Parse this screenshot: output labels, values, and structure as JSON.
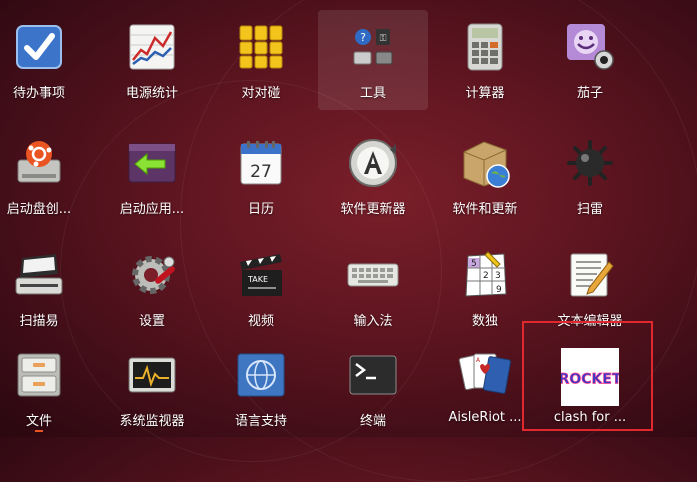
{
  "apps": [
    {
      "label": "待办事项",
      "icon": "todo-checkbox-icon"
    },
    {
      "label": "电源统计",
      "icon": "power-stats-chart-icon"
    },
    {
      "label": "对对碰",
      "icon": "swell-foop-icon"
    },
    {
      "label": "工具",
      "icon": "utilities-folder-icon"
    },
    {
      "label": "计算器",
      "icon": "calculator-icon"
    },
    {
      "label": "茄子",
      "icon": "cheese-webcam-icon"
    },
    {
      "label": "启动盘创...",
      "icon": "startup-disk-icon"
    },
    {
      "label": "启动应用...",
      "icon": "startup-apps-icon"
    },
    {
      "label": "日历",
      "icon": "calendar-icon"
    },
    {
      "label": "软件更新器",
      "icon": "software-updater-icon"
    },
    {
      "label": "软件和更新",
      "icon": "software-sources-icon"
    },
    {
      "label": "扫雷",
      "icon": "mines-icon"
    },
    {
      "label": "扫描易",
      "icon": "scanner-icon"
    },
    {
      "label": "设置",
      "icon": "settings-gear-icon"
    },
    {
      "label": "视频",
      "icon": "video-clapper-icon"
    },
    {
      "label": "输入法",
      "icon": "keyboard-icon"
    },
    {
      "label": "数独",
      "icon": "sudoku-icon"
    },
    {
      "label": "文本编辑器",
      "icon": "text-editor-icon"
    },
    {
      "label": "文件",
      "icon": "files-cabinet-icon"
    },
    {
      "label": "系统监视器",
      "icon": "system-monitor-icon"
    },
    {
      "label": "语言支持",
      "icon": "language-support-icon"
    },
    {
      "label": "终端",
      "icon": "terminal-icon"
    },
    {
      "label": "AisleRiot ...",
      "icon": "aisleriot-cards-icon"
    },
    {
      "label": "clash for ...",
      "icon": "rocket-clash-icon",
      "icon_text": "ROCKET"
    }
  ],
  "calendar_day": "27",
  "colors": {
    "highlight": "#e0282e",
    "running_indicator": "#e95420"
  }
}
